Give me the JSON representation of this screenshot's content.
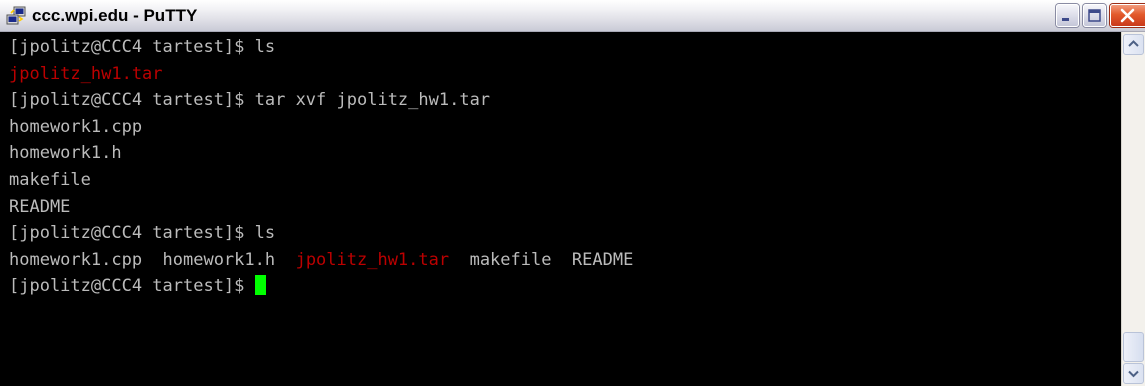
{
  "window": {
    "title": "ccc.wpi.edu - PuTTY",
    "icon": "putty-app-icon",
    "buttons": {
      "minimize_icon": "minimize-icon",
      "maximize_icon": "maximize-icon",
      "close_icon": "close-icon"
    }
  },
  "terminal": {
    "background": "#000000",
    "text_color": "#bbbbbb",
    "archive_color": "#bb0000",
    "cursor_color": "#00ff00",
    "lines": [
      {
        "text": "[jpolitz@CCC4 tartest]$ ls"
      },
      {
        "red": "jpolitz_hw1.tar"
      },
      {
        "text": "[jpolitz@CCC4 tartest]$ tar xvf jpolitz_hw1.tar"
      },
      {
        "text": "homework1.cpp"
      },
      {
        "text": "homework1.h"
      },
      {
        "text": "makefile"
      },
      {
        "text": "README"
      },
      {
        "text": "[jpolitz@CCC4 tartest]$ ls"
      },
      {
        "pre": "homework1.cpp  homework1.h  ",
        "red": "jpolitz_hw1.tar",
        "post": "  makefile  README"
      },
      {
        "text": "[jpolitz@CCC4 tartest]$ "
      }
    ]
  },
  "scrollbar": {
    "up_icon": "scroll-up-arrow-icon",
    "down_icon": "scroll-down-arrow-icon"
  }
}
